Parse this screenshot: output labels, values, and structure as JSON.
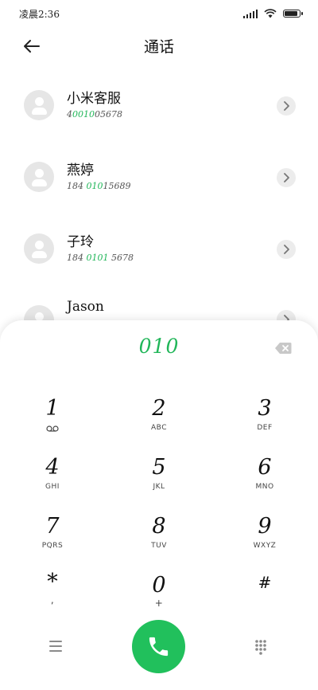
{
  "status": {
    "time": "凌晨2:36"
  },
  "header": {
    "title": "通话"
  },
  "contacts": [
    {
      "name": "小米客服",
      "num_pre": "4",
      "num_hl": "0010",
      "num_post": "05678"
    },
    {
      "name": "燕婷",
      "num_pre": "184 ",
      "num_hl": "010",
      "num_post": "15689"
    },
    {
      "name": "子玲",
      "num_pre": "184 ",
      "num_hl": "0101",
      "num_post": " 5678"
    },
    {
      "name": "Jason",
      "num_pre": "",
      "num_hl": "",
      "num_post": ""
    }
  ],
  "dialpad": {
    "input": "010",
    "keys": [
      {
        "digit": "1",
        "letters": ""
      },
      {
        "digit": "2",
        "letters": "ABC"
      },
      {
        "digit": "3",
        "letters": "DEF"
      },
      {
        "digit": "4",
        "letters": "GHI"
      },
      {
        "digit": "5",
        "letters": "JKL"
      },
      {
        "digit": "6",
        "letters": "MNO"
      },
      {
        "digit": "7",
        "letters": "PQRS"
      },
      {
        "digit": "8",
        "letters": "TUV"
      },
      {
        "digit": "9",
        "letters": "WXYZ"
      },
      {
        "digit": "*",
        "letters": ","
      },
      {
        "digit": "0",
        "letters": "+"
      },
      {
        "digit": "#",
        "letters": ""
      }
    ]
  },
  "colors": {
    "accent": "#21c05c",
    "highlight": "#21b659"
  },
  "icons": {
    "back": "arrow-left-icon",
    "backspace": "backspace-icon",
    "call": "phone-icon",
    "menu": "menu-icon",
    "keypad": "keypad-icon",
    "voicemail": "voicemail-icon"
  }
}
